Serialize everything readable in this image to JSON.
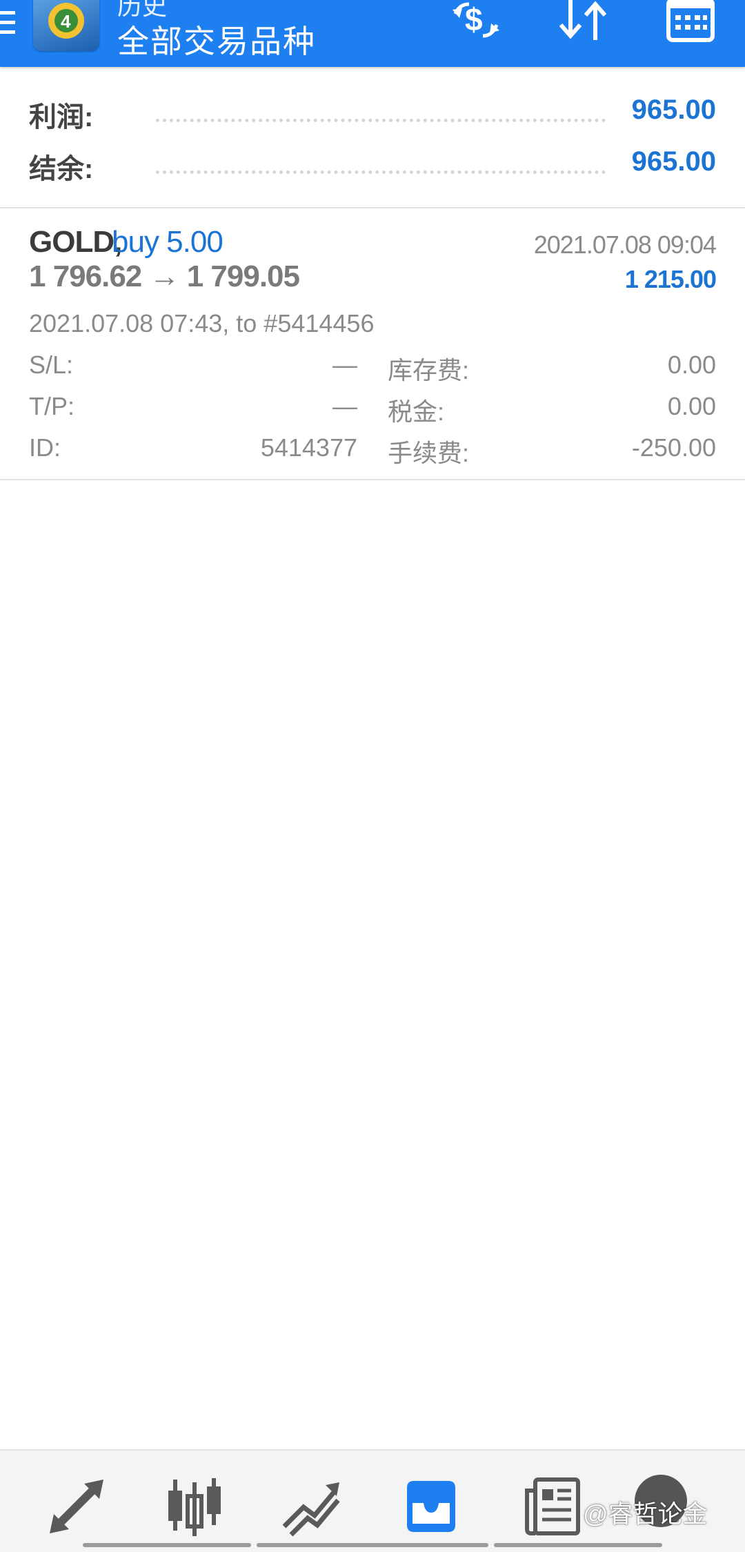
{
  "header": {
    "title_small": "历史",
    "title_main": "全部交易品种"
  },
  "summary": {
    "profit_label": "利润:",
    "profit_value": "965.00",
    "balance_label": "结余:",
    "balance_value": "965.00"
  },
  "deal": {
    "symbol": "GOLD,",
    "type": "buy 5.00",
    "close_time": "2021.07.08 09:04",
    "prices": "1 796.62 → 1 799.05",
    "profit": "1 215.00",
    "open_info": "2021.07.08 07:43, to #5414456",
    "sl_label": "S/L:",
    "sl_value": "—",
    "tp_label": "T/P:",
    "tp_value": "—",
    "id_label": "ID:",
    "id_value": "5414377",
    "swap_label": "库存费:",
    "swap_value": "0.00",
    "tax_label": "税金:",
    "tax_value": "0.00",
    "commission_label": "手续费:",
    "commission_value": "-250.00"
  },
  "bottom_nav": {
    "items": [
      {
        "icon": "quotes-arrows-icon"
      },
      {
        "icon": "candlestick-chart-icon"
      },
      {
        "icon": "trade-chart-icon"
      },
      {
        "icon": "history-inbox-icon",
        "active": true
      },
      {
        "icon": "news-icon"
      },
      {
        "icon": "avatar"
      }
    ]
  },
  "watermark": "@睿哲论金",
  "colors": {
    "header_bg": "#1d7ff0",
    "accent_blue": "#1b74d4",
    "text_dark": "#444444",
    "text_gray": "#8a8a8a"
  }
}
